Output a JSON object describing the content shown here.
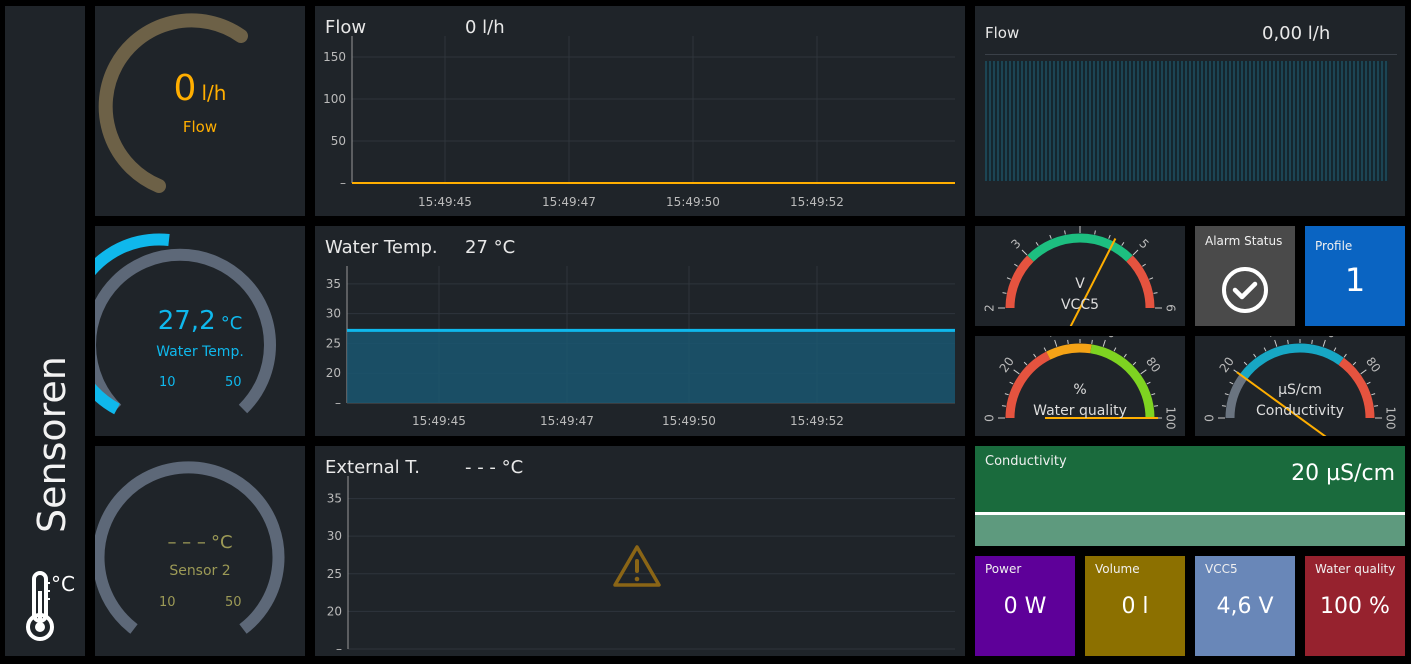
{
  "sidebar": {
    "title": "Sensoren",
    "unit": "°C",
    "icon": "thermometer-icon"
  },
  "gauges": {
    "flow": {
      "value": "0",
      "unit": "l/h",
      "label": "Flow",
      "color": "#ffae00"
    },
    "water_temp": {
      "value": "27,2",
      "unit": "°C",
      "label": "Water Temp.",
      "min": "10",
      "max": "50",
      "fraction": 0.43,
      "color": "#0fb8ec"
    },
    "sensor2": {
      "value": "– – –",
      "unit": "°C",
      "label": "Sensor 2",
      "min": "10",
      "max": "50",
      "color": "#9c9a56"
    }
  },
  "charts": {
    "flow": {
      "title": "Flow",
      "current": "0 l/h"
    },
    "water_temp": {
      "title": "Water Temp.",
      "current": "27 °C"
    },
    "external": {
      "title": "External T.",
      "current": "- - - °C",
      "warning_icon": "warning-icon"
    }
  },
  "chart_data": [
    {
      "type": "line",
      "title": "Flow",
      "x": [
        "15:49:45",
        "15:49:47",
        "15:49:50",
        "15:49:52"
      ],
      "yticks": [
        "150",
        "100",
        "50",
        "–"
      ],
      "ylim": [
        0,
        175
      ],
      "series": [
        {
          "values": [
            0,
            0,
            0,
            0
          ]
        }
      ],
      "color": "#ffae00"
    },
    {
      "type": "area",
      "title": "Water Temp.",
      "x": [
        "15:49:45",
        "15:49:47",
        "15:49:50",
        "15:49:52"
      ],
      "yticks": [
        "35",
        "30",
        "25",
        "20",
        "–"
      ],
      "ylim": [
        15,
        38
      ],
      "series": [
        {
          "values": [
            27.2,
            27.2,
            27.2,
            27.2
          ]
        }
      ],
      "color": "#0fb8ec"
    },
    {
      "type": "line",
      "title": "External T.",
      "x": [],
      "yticks": [
        "35",
        "30",
        "25",
        "20",
        "–"
      ],
      "ylim": [
        15,
        38
      ],
      "series": []
    }
  ],
  "flow_panel": {
    "title": "Flow",
    "value": "0,00 l/h"
  },
  "vcc_gauge": {
    "unit": "V",
    "label": "VCC5",
    "ticks": [
      "2",
      "3",
      "4",
      "5",
      "6"
    ],
    "value": 4.6
  },
  "alarm": {
    "title": "Alarm Status",
    "icon": "check-circle-icon"
  },
  "profile": {
    "title": "Profile",
    "value": "1",
    "color": "#0a64c2"
  },
  "water_quality_gauge": {
    "unit": "%",
    "label": "Water quality",
    "ticks": [
      "0",
      "20",
      "40",
      "60",
      "80",
      "100"
    ],
    "value": 100
  },
  "conductivity_gauge": {
    "unit": "µS/cm",
    "label": "Conductivity",
    "ticks": [
      "0",
      "20",
      "40",
      "60",
      "80",
      "100"
    ],
    "value": 20
  },
  "conductivity_panel": {
    "title": "Conductivity",
    "value": "20 µS/cm"
  },
  "tiles": [
    {
      "title": "Power",
      "value": "0 W",
      "color": "#5e0099"
    },
    {
      "title": "Volume",
      "value": "0 l",
      "color": "#8c7000"
    },
    {
      "title": "VCC5",
      "value": "4,6 V",
      "color": "#6987b8"
    },
    {
      "title": "Water quality",
      "value": "100 %",
      "color": "#96222e"
    }
  ]
}
